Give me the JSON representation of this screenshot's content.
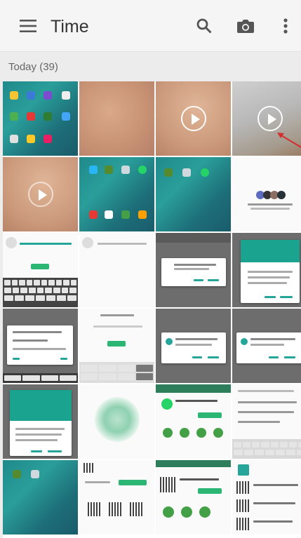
{
  "header": {
    "title": "Time",
    "menu_icon": "hamburger-menu-icon",
    "search_icon": "search-icon",
    "camera_icon": "camera-icon",
    "more_icon": "more-vert-icon"
  },
  "section": {
    "label": "Today (39)"
  },
  "colors": {
    "appbar_bg": "#f5f5f5",
    "accent_green": "#2bb673",
    "whatsapp_teal": "#0a8a7a"
  }
}
